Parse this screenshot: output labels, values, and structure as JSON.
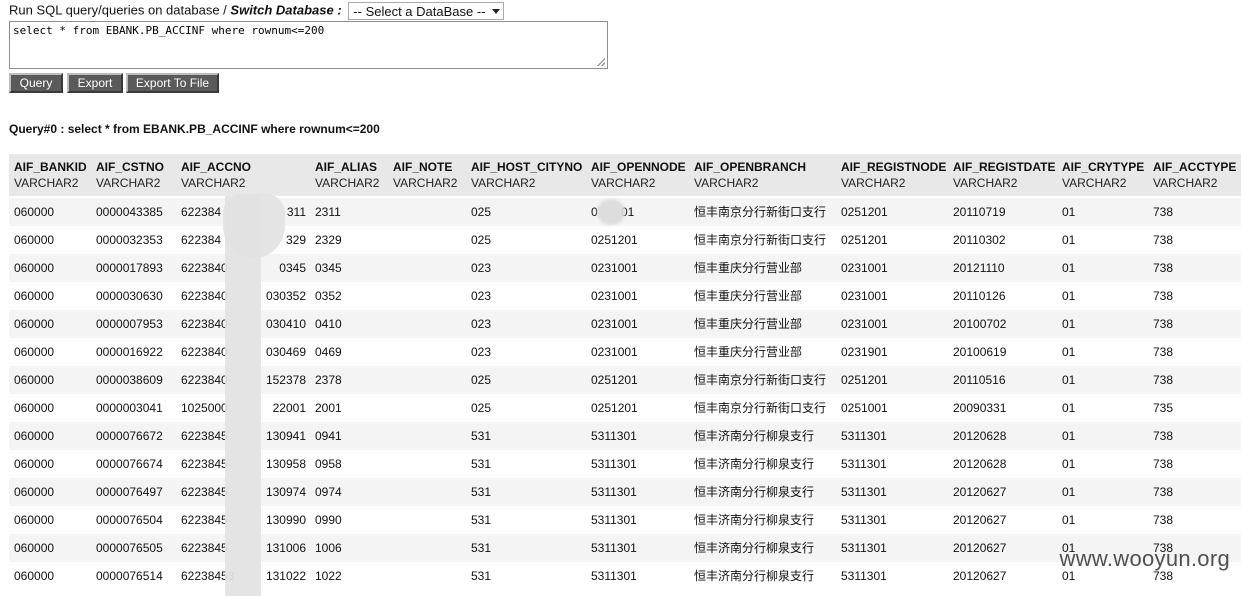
{
  "header": {
    "prompt": "Run SQL query/queries on database /",
    "switch_label": "Switch Database :",
    "db_select_value": "-- Select a DataBase --"
  },
  "query_text": "select * from EBANK.PB_ACCINF where rownum<=200",
  "buttons": {
    "query": "Query",
    "export": "Export",
    "export_file": "Export To File"
  },
  "result_title": "Query#0 : select * from EBANK.PB_ACCINF where rownum<=200",
  "columns": [
    {
      "name": "AIF_BANKID",
      "type": "VARCHAR2"
    },
    {
      "name": "AIF_CSTNO",
      "type": "VARCHAR2"
    },
    {
      "name": "AIF_ACCNO",
      "type": "VARCHAR2"
    },
    {
      "name": "AIF_ALIAS",
      "type": "VARCHAR2"
    },
    {
      "name": "AIF_NOTE",
      "type": "VARCHAR2"
    },
    {
      "name": "AIF_HOST_CITYNO",
      "type": "VARCHAR2"
    },
    {
      "name": "AIF_OPENNODE",
      "type": "VARCHAR2"
    },
    {
      "name": "AIF_OPENBRANCH",
      "type": "VARCHAR2"
    },
    {
      "name": "AIF_REGISTNODE",
      "type": "VARCHAR2"
    },
    {
      "name": "AIF_REGISTDATE",
      "type": "VARCHAR2"
    },
    {
      "name": "AIF_CRYTYPE",
      "type": "VARCHAR2"
    },
    {
      "name": "AIF_ACCTYPE",
      "type": "VARCHAR2"
    }
  ],
  "rows": [
    [
      "060000",
      "0000043385",
      "622384",
      "311",
      "2311",
      "",
      "025",
      "0",
      "01",
      "恒丰南京分行新街口支行",
      "0251201",
      "20110719",
      "01",
      "738"
    ],
    [
      "060000",
      "0000032353",
      "622384",
      "329",
      "2329",
      "",
      "025",
      "0251201",
      "",
      "恒丰南京分行新街口支行",
      "0251201",
      "20110302",
      "01",
      "738"
    ],
    [
      "060000",
      "0000017893",
      "6223840",
      "0345",
      "0345",
      "",
      "023",
      "0231001",
      "",
      "恒丰重庆分行营业部",
      "0231001",
      "20121110",
      "01",
      "738"
    ],
    [
      "060000",
      "0000030630",
      "6223840",
      "030352",
      "0352",
      "",
      "023",
      "0231001",
      "",
      "恒丰重庆分行营业部",
      "0231001",
      "20110126",
      "01",
      "738"
    ],
    [
      "060000",
      "0000007953",
      "6223840",
      "030410",
      "0410",
      "",
      "023",
      "0231001",
      "",
      "恒丰重庆分行营业部",
      "0231001",
      "20100702",
      "01",
      "738"
    ],
    [
      "060000",
      "0000016922",
      "6223840",
      "030469",
      "0469",
      "",
      "023",
      "0231001",
      "",
      "恒丰重庆分行营业部",
      "0231901",
      "20100619",
      "01",
      "738"
    ],
    [
      "060000",
      "0000038609",
      "6223840",
      "152378",
      "2378",
      "",
      "025",
      "0251201",
      "",
      "恒丰南京分行新街口支行",
      "0251201",
      "20110516",
      "01",
      "738"
    ],
    [
      "060000",
      "0000003041",
      "1025000",
      "22001",
      "2001",
      "",
      "025",
      "0251201",
      "",
      "恒丰南京分行新街口支行",
      "0251001",
      "20090331",
      "01",
      "735"
    ],
    [
      "060000",
      "0000076672",
      "6223845",
      "130941",
      "0941",
      "",
      "531",
      "5311301",
      "",
      "恒丰济南分行柳泉支行",
      "5311301",
      "20120628",
      "01",
      "738"
    ],
    [
      "060000",
      "0000076674",
      "6223845",
      "130958",
      "0958",
      "",
      "531",
      "5311301",
      "",
      "恒丰济南分行柳泉支行",
      "5311301",
      "20120628",
      "01",
      "738"
    ],
    [
      "060000",
      "0000076497",
      "6223845",
      "130974",
      "0974",
      "",
      "531",
      "5311301",
      "",
      "恒丰济南分行柳泉支行",
      "5311301",
      "20120627",
      "01",
      "738"
    ],
    [
      "060000",
      "0000076504",
      "6223845",
      "130990",
      "0990",
      "",
      "531",
      "5311301",
      "",
      "恒丰济南分行柳泉支行",
      "5311301",
      "20120627",
      "01",
      "738"
    ],
    [
      "060000",
      "0000076505",
      "6223845",
      "131006",
      "1006",
      "",
      "531",
      "5311301",
      "",
      "恒丰济南分行柳泉支行",
      "5311301",
      "20120627",
      "01",
      "738"
    ],
    [
      "060000",
      "0000076514",
      "62238453",
      "131022",
      "1022",
      "",
      "531",
      "5311301",
      "",
      "恒丰济南分行柳泉支行",
      "5311301",
      "20120627",
      "01",
      "738"
    ]
  ],
  "watermark": "www.wooyun.org"
}
